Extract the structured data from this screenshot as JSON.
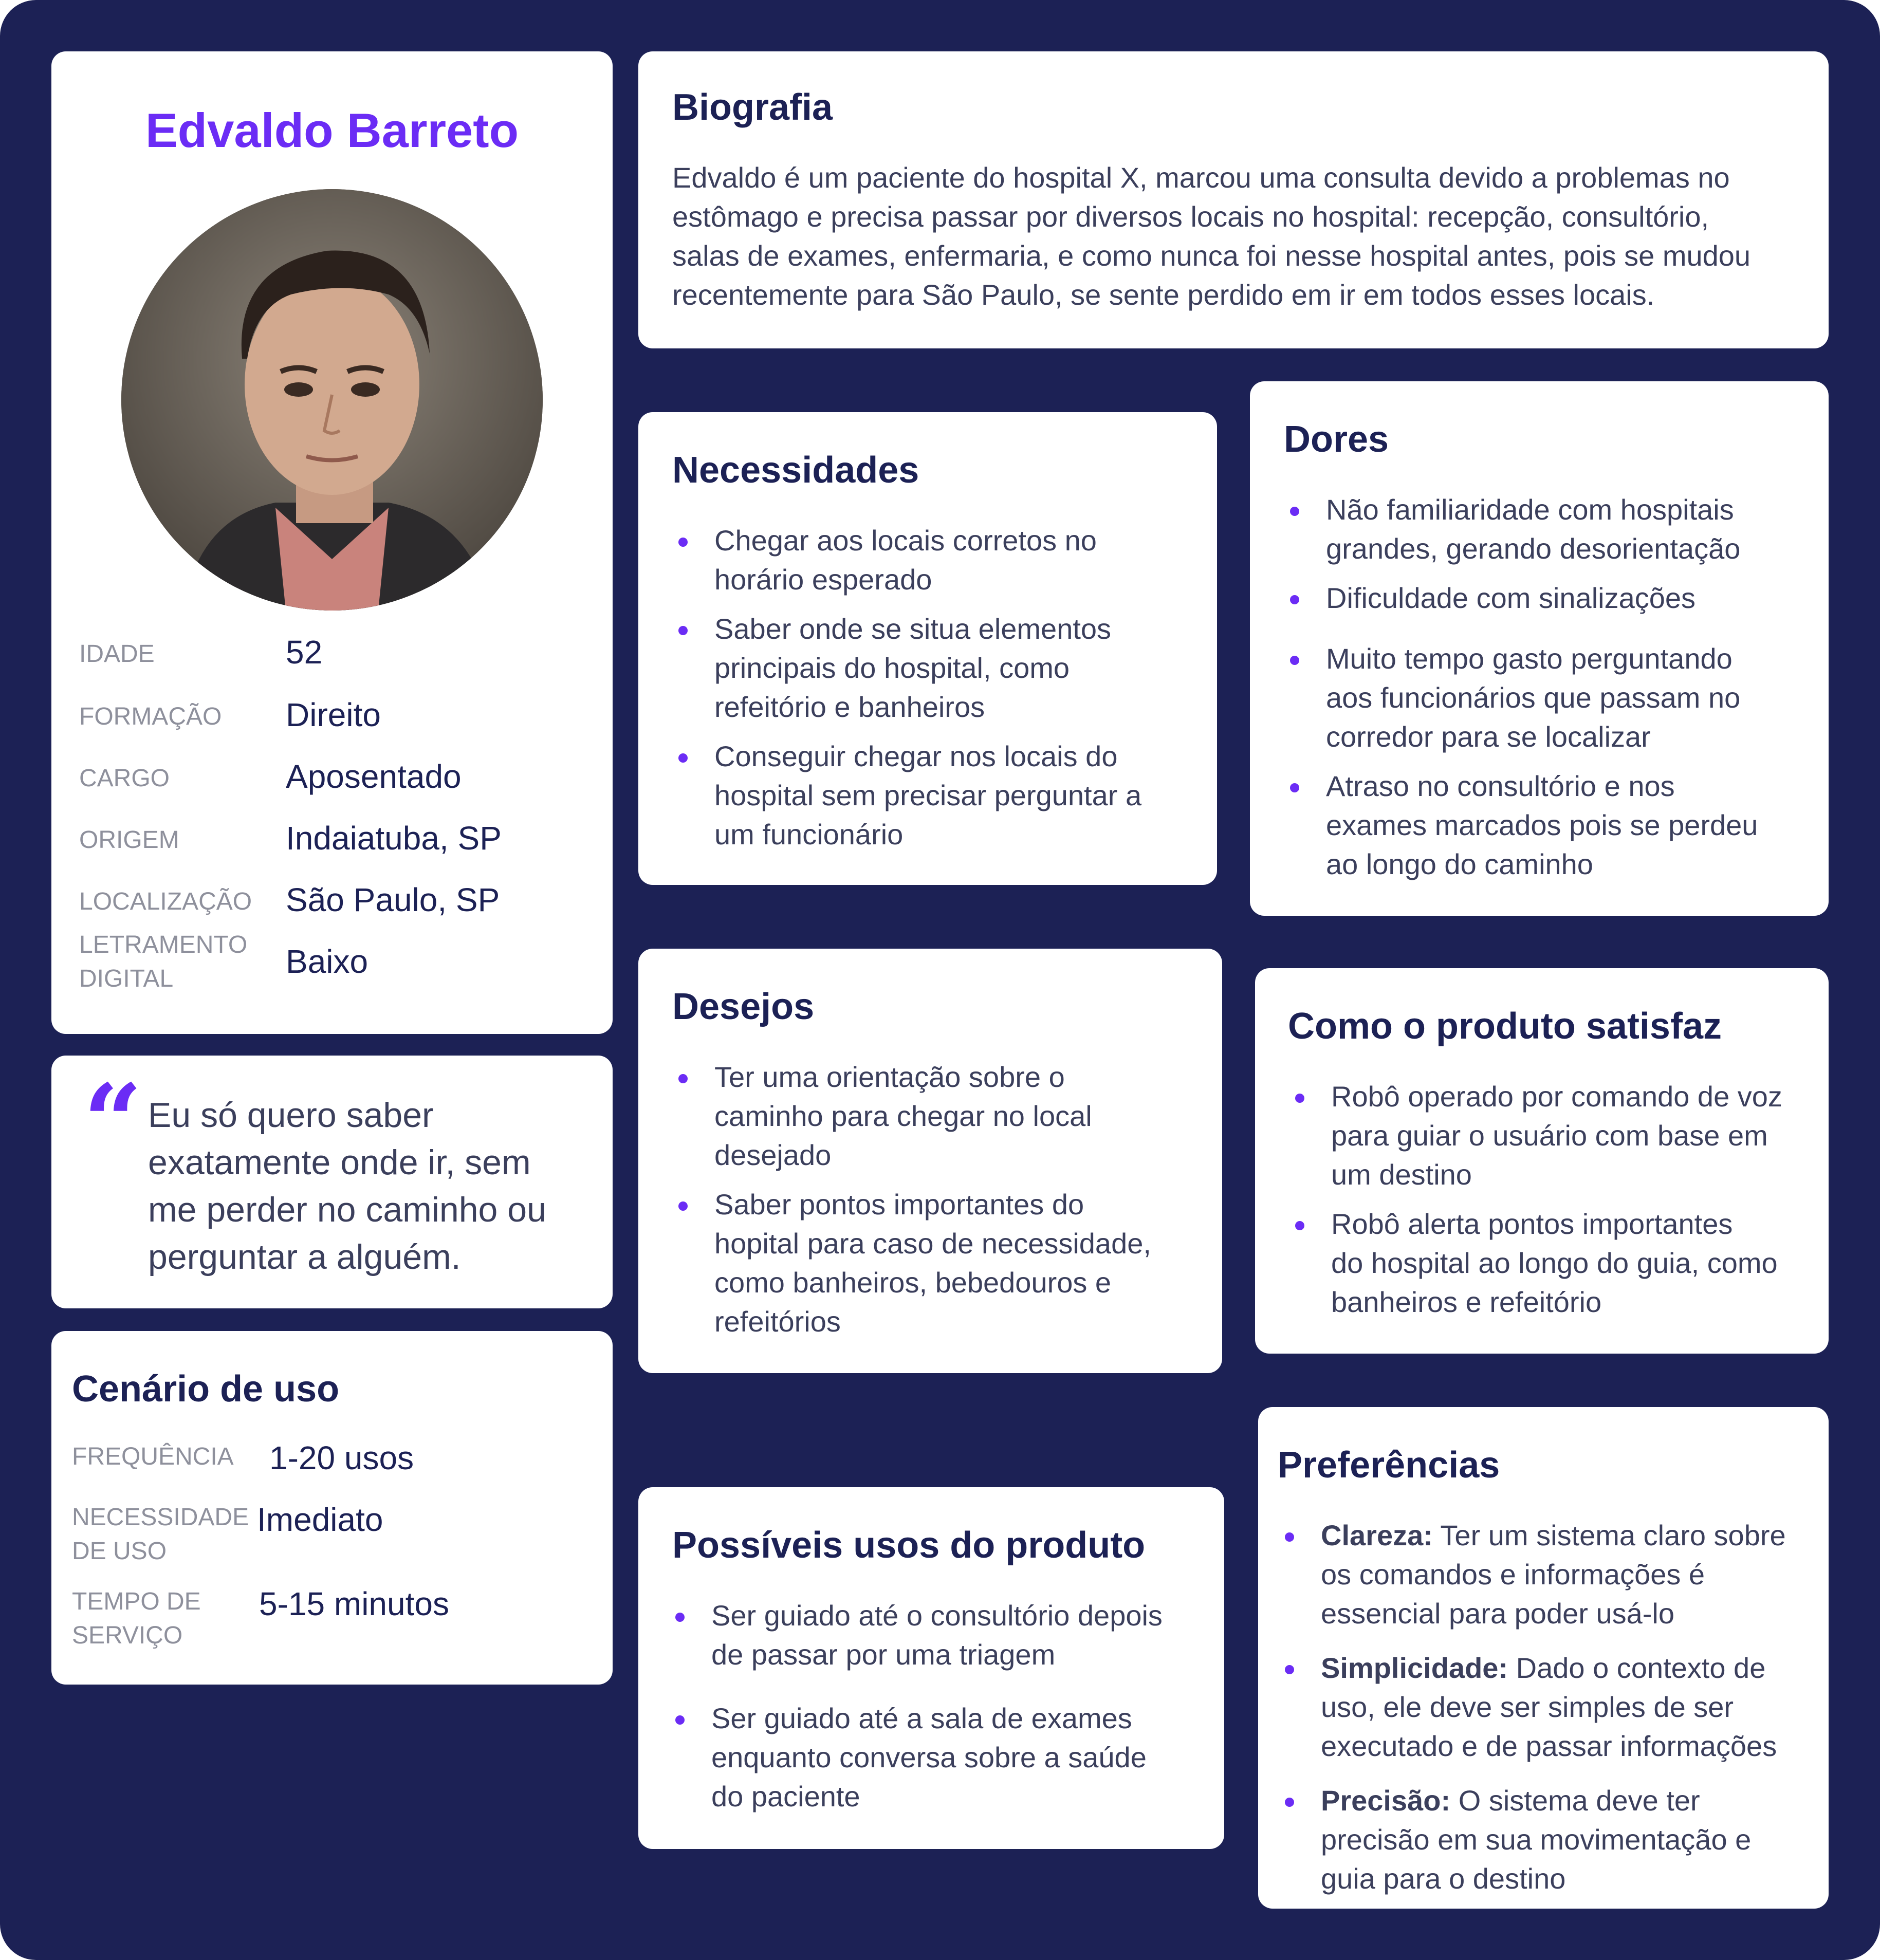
{
  "persona": {
    "name": "Edvaldo Barreto",
    "photo_icon": "person-portrait",
    "details": [
      {
        "label": "IDADE",
        "value": "52"
      },
      {
        "label": "FORMAÇÃO",
        "value": "Direito"
      },
      {
        "label": "CARGO",
        "value": "Aposentado"
      },
      {
        "label": "ORIGEM",
        "value": "Indaiatuba, SP"
      },
      {
        "label": "LOCALIZAÇÃO",
        "value": "São Paulo, SP"
      },
      {
        "label_line1": "LETRAMENTO",
        "label_line2": "DIGITAL",
        "value": "Baixo"
      }
    ]
  },
  "quote": {
    "icon": "quote-icon",
    "lines": [
      "Eu só quero saber",
      "exatamente onde ir, sem",
      "me perder no caminho ou",
      "perguntar a alguém."
    ]
  },
  "cenario": {
    "title": "Cenário de uso",
    "rows": [
      {
        "label_line1": "FREQUÊNCIA",
        "label_line2": "",
        "value": "1-20 usos"
      },
      {
        "label_line1": "NECESSIDADE",
        "label_line2": "DE USO",
        "value": "Imediato"
      },
      {
        "label_line1": "TEMPO DE",
        "label_line2": "SERVIÇO",
        "value": "5-15 minutos"
      }
    ]
  },
  "biografia": {
    "title": "Biografia",
    "lines": [
      "Edvaldo é um paciente do hospital X, marcou uma consulta devido a problemas no",
      "estômago e precisa passar por diversos locais no hospital: recepção, consultório,",
      "salas de exames, enfermaria, e como nunca foi nesse hospital antes, pois se mudou",
      "recentemente para São Paulo, se sente perdido em ir em todos esses locais."
    ]
  },
  "necessidades": {
    "title": "Necessidades",
    "items": [
      [
        "Chegar aos locais corretos no",
        "horário esperado"
      ],
      [
        "Saber onde se situa elementos",
        "principais do hospital, como",
        "refeitório e banheiros"
      ],
      [
        "Conseguir chegar nos locais do",
        "hospital sem precisar perguntar a",
        "um funcionário"
      ]
    ]
  },
  "dores": {
    "title": "Dores",
    "items": [
      [
        "Não familiaridade com hospitais",
        "grandes, gerando desorientação"
      ],
      [
        "Dificuldade com sinalizações"
      ],
      [
        "Muito tempo gasto perguntando",
        "aos funcionários que passam no",
        "corredor para se localizar"
      ],
      [
        "Atraso no consultório e nos",
        "exames marcados pois se perdeu",
        "ao longo do caminho"
      ]
    ]
  },
  "desejos": {
    "title": "Desejos",
    "items": [
      [
        "Ter uma orientação sobre o",
        "caminho para chegar no local",
        "desejado"
      ],
      [
        "Saber pontos importantes do",
        "hopital para caso de necessidade,",
        "como banheiros, bebedouros e",
        "refeitórios"
      ]
    ]
  },
  "satisfaz": {
    "title": "Como o produto satisfaz",
    "items": [
      [
        "Robô operado por comando de voz",
        "para guiar o usuário com base em",
        "um destino"
      ],
      [
        "Robô alerta pontos importantes",
        "do hospital ao longo do guia, como",
        "banheiros e refeitório"
      ]
    ]
  },
  "usos": {
    "title": "Possíveis usos do produto",
    "items": [
      [
        "Ser guiado até o consultório depois",
        "de passar por uma triagem"
      ],
      [
        "Ser guiado até a sala de exames",
        "enquanto conversa sobre a saúde",
        "do paciente"
      ]
    ]
  },
  "preferencias": {
    "title": "Preferências",
    "items": [
      {
        "bold": "Clareza:",
        "lines": [
          "Ter um sistema claro sobre",
          "os comandos e informações é",
          "essencial para poder usá-lo"
        ]
      },
      {
        "bold": "Simplicidade:",
        "lines": [
          "Dado o contexto de",
          "uso, ele deve ser simples de ser",
          "executado e de passar informações"
        ]
      },
      {
        "bold": "Precisão:",
        "lines": [
          "O sistema deve ter",
          "precisão em sua movimentação e",
          "guia para o destino"
        ]
      }
    ]
  },
  "colors": {
    "background": "#1c2155",
    "accent": "#6b2cf5",
    "card": "#ffffff"
  }
}
